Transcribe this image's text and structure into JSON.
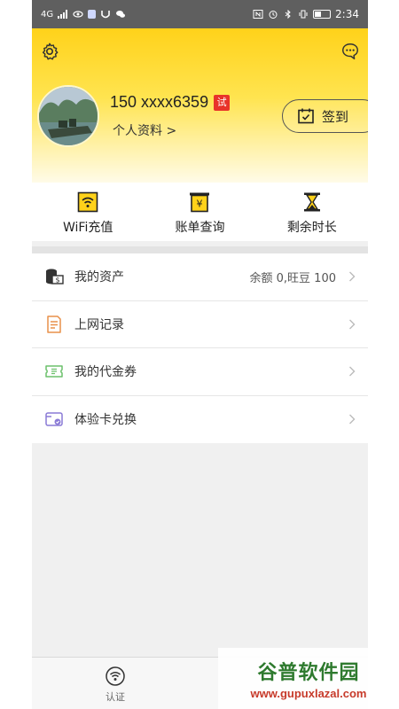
{
  "statusbar": {
    "network": "4G",
    "time": "2:34"
  },
  "profile": {
    "nickname": "150 xxxx6359",
    "trial_badge": "试",
    "profile_link": "个人资料 >"
  },
  "signin": {
    "label": "签到"
  },
  "quick_actions": [
    {
      "label": "WiFi充值",
      "icon": "wifi-recharge-icon"
    },
    {
      "label": "账单查询",
      "icon": "bill-icon"
    },
    {
      "label": "剩余时长",
      "icon": "hourglass-icon"
    }
  ],
  "menu": [
    {
      "label": "我的资产",
      "value": "余额 0,旺豆 100",
      "icon": "assets-icon"
    },
    {
      "label": "上网记录",
      "value": "",
      "icon": "record-icon"
    },
    {
      "label": "我的代金券",
      "value": "",
      "icon": "voucher-icon"
    },
    {
      "label": "体验卡兑换",
      "value": "",
      "icon": "card-icon"
    }
  ],
  "bottom_nav": {
    "auth_label": "认证"
  },
  "watermark": {
    "title": "谷普软件园",
    "url": "www.gupuxlazal.com"
  },
  "colors": {
    "header_yellow": "#ffd21a",
    "accent_red": "#e8332a",
    "statusbar": "#5f5f5f"
  }
}
